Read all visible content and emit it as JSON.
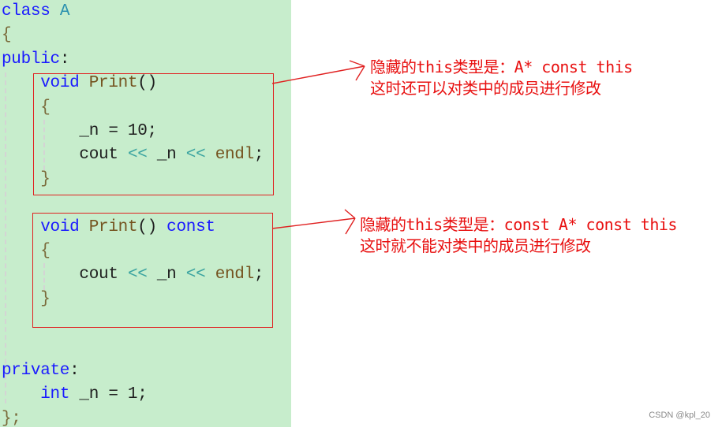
{
  "code": {
    "lines": [
      {
        "tokens": [
          {
            "t": "class ",
            "c": "kw"
          },
          {
            "t": "A",
            "c": "ty"
          }
        ]
      },
      {
        "tokens": [
          {
            "t": "{",
            "c": "pl"
          }
        ]
      },
      {
        "tokens": [
          {
            "t": "public",
            "c": "kw"
          },
          {
            "t": ":",
            "c": "tx"
          }
        ]
      },
      {
        "tokens": [
          {
            "t": "    ",
            "c": "tx"
          },
          {
            "t": "void",
            "c": "kw"
          },
          {
            "t": " ",
            "c": "tx"
          },
          {
            "t": "Print",
            "c": "fn"
          },
          {
            "t": "()",
            "c": "tx"
          }
        ]
      },
      {
        "tokens": [
          {
            "t": "    {",
            "c": "pl"
          }
        ]
      },
      {
        "tokens": [
          {
            "t": "        _n = 10;",
            "c": "tx"
          }
        ]
      },
      {
        "tokens": [
          {
            "t": "        cout ",
            "c": "tx"
          },
          {
            "t": "<<",
            "c": "op"
          },
          {
            "t": " _n ",
            "c": "tx"
          },
          {
            "t": "<<",
            "c": "op"
          },
          {
            "t": " ",
            "c": "tx"
          },
          {
            "t": "endl",
            "c": "fn"
          },
          {
            "t": ";",
            "c": "tx"
          }
        ]
      },
      {
        "tokens": [
          {
            "t": "    }",
            "c": "pl"
          }
        ]
      },
      {
        "tokens": []
      },
      {
        "tokens": [
          {
            "t": "    ",
            "c": "tx"
          },
          {
            "t": "void",
            "c": "kw"
          },
          {
            "t": " ",
            "c": "tx"
          },
          {
            "t": "Print",
            "c": "fn"
          },
          {
            "t": "() ",
            "c": "tx"
          },
          {
            "t": "const",
            "c": "kw"
          }
        ]
      },
      {
        "tokens": [
          {
            "t": "    {",
            "c": "pl"
          }
        ]
      },
      {
        "tokens": [
          {
            "t": "        cout ",
            "c": "tx"
          },
          {
            "t": "<<",
            "c": "op"
          },
          {
            "t": " _n ",
            "c": "tx"
          },
          {
            "t": "<<",
            "c": "op"
          },
          {
            "t": " ",
            "c": "tx"
          },
          {
            "t": "endl",
            "c": "fn"
          },
          {
            "t": ";",
            "c": "tx"
          }
        ]
      },
      {
        "tokens": [
          {
            "t": "    }",
            "c": "pl"
          }
        ]
      },
      {
        "tokens": []
      },
      {
        "tokens": []
      },
      {
        "tokens": [
          {
            "t": "private",
            "c": "kw"
          },
          {
            "t": ":",
            "c": "tx"
          }
        ]
      },
      {
        "tokens": [
          {
            "t": "    ",
            "c": "tx"
          },
          {
            "t": "int",
            "c": "kw"
          },
          {
            "t": " _n = 1;",
            "c": "tx"
          }
        ]
      },
      {
        "tokens": [
          {
            "t": "};",
            "c": "pl"
          }
        ]
      }
    ]
  },
  "annotations": {
    "non_const": {
      "line1": "隐藏的this类型是：A* const this",
      "line2": "这时还可以对类中的成员进行修改"
    },
    "const": {
      "line1": "隐藏的this类型是：const A* const this",
      "line2": "这时就不能对类中的成员进行修改"
    }
  },
  "colors": {
    "code_background": "#c7edcc",
    "annotation": "#e81010",
    "keyword": "#1a1aff",
    "type": "#2b91af",
    "function": "#74531f",
    "operator": "#3aa3a0"
  },
  "watermark": "CSDN @kpl_20"
}
